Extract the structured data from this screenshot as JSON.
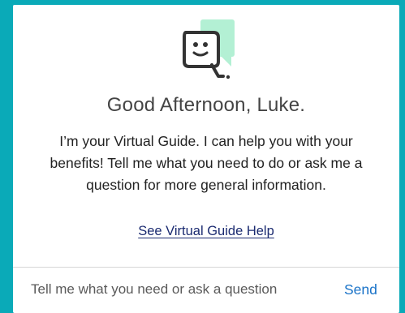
{
  "colors": {
    "backdrop": "#0aaab8",
    "bubble_accent": "#b3f0d4",
    "link": "#1a2a70",
    "send": "#1a73c8"
  },
  "logo": {
    "icon": "virtual-guide-chat-face-icon"
  },
  "greeting": "Good Afternoon, Luke.",
  "intro_lines": [
    "I’m your Virtual Guide. I can help you with your",
    "benefits! Tell me what you need to do or ask me a",
    "question for more general information."
  ],
  "help_link": "See Virtual Guide Help",
  "composer": {
    "placeholder": "Tell me what you need or ask a question",
    "send_label": "Send"
  }
}
